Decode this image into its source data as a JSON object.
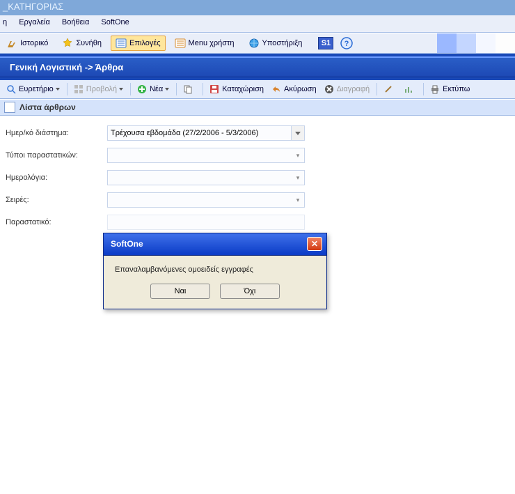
{
  "category_bar": "_ΚΑΤΗΓΟΡΙΑΣ",
  "menu": {
    "items": [
      "η",
      "Εργαλεία",
      "Βοήθεια",
      "SoftOne"
    ]
  },
  "toolbar_top": {
    "history": "Ιστορικό",
    "favorites": "Συνήθη",
    "options": "Επιλογές",
    "usermenu": "Menu χρήστη",
    "support": "Υποστήριξη",
    "s1": "S1"
  },
  "breadcrumb": "Γενική Λογιστική -> Άρθρα",
  "toolbar_actions": {
    "index": "Ευρετήριο",
    "view": "Προβολή",
    "new": "Νέα",
    "save": "Καταχώριση",
    "cancel": "Ακύρωση",
    "delete": "Διαγραφή",
    "print": "Εκτύπω"
  },
  "section_title": "Λίστα άρθρων",
  "form": {
    "date_range_label": "Ημερ/κό διάστημα:",
    "date_range_value": "Τρέχουσα εβδομάδα (27/2/2006 - 5/3/2006)",
    "doc_types_label": "Τύποι παραστατικών:",
    "journals_label": "Ημερολόγια:",
    "series_label": "Σειρές:",
    "document_label": "Παραστατικό:"
  },
  "dialog": {
    "title": "SoftOne",
    "message": "Επαναλαμβανόμενες ομοειδείς εγγραφές",
    "yes": "Ναι",
    "no": "Όχι"
  }
}
